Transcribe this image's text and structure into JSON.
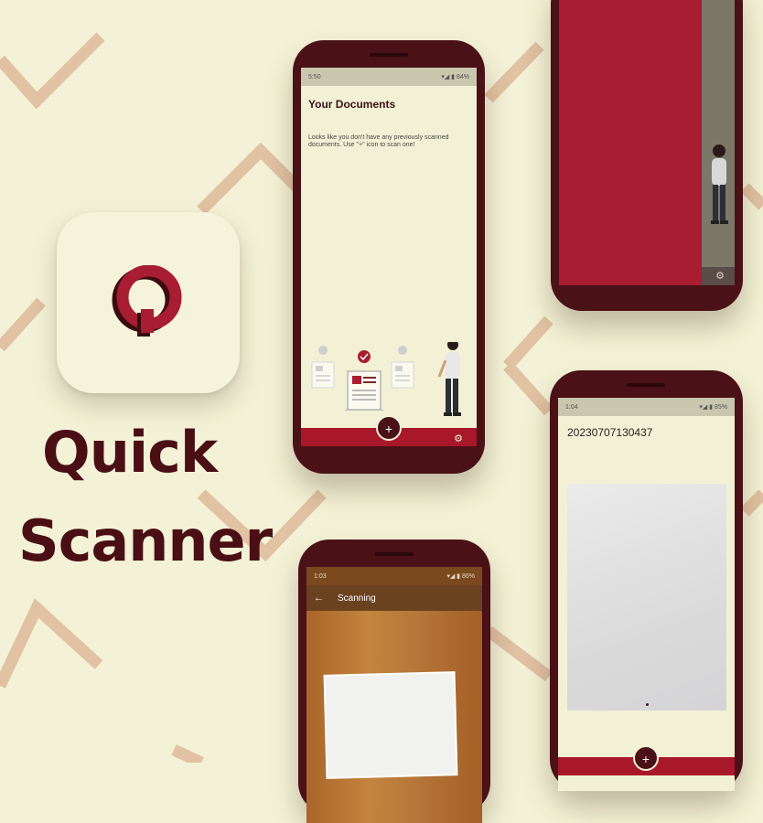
{
  "colors": {
    "background": "#f4f2d6",
    "brand_dark": "#4a1117",
    "brand_red": "#a8172a",
    "chevron": "#e1c2a3"
  },
  "app": {
    "title_line1": "Quick",
    "title_line2": "Scanner",
    "icon": "q-logo-icon"
  },
  "phone_main": {
    "status_time": "5:50",
    "status_right": "▾◢ ▮ 84%",
    "heading": "Your Documents",
    "empty_message": "Looks like you don't have any previously scanned documents. Use \"+\" icon to scan one!",
    "fab_label": "+",
    "settings_icon": "gear-icon"
  },
  "phone_result": {
    "status_time": "1:04",
    "status_right": "▾◢ ▮ 85%",
    "document_name": "20230707130437",
    "fab_label": "+"
  },
  "phone_scanning": {
    "status_time": "1:03",
    "status_right": "▾◢ ▮ 86%",
    "appbar_title": "Scanning",
    "back_icon": "arrow-left-icon"
  }
}
